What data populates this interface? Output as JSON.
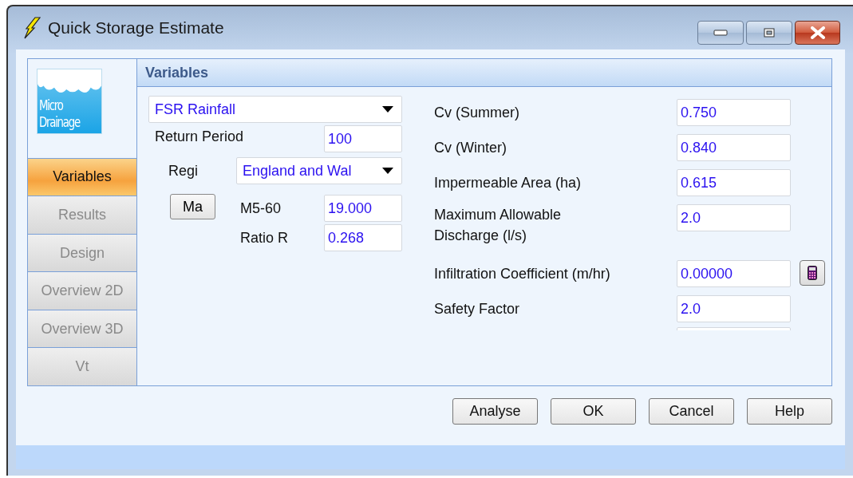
{
  "window": {
    "title": "Quick Storage Estimate"
  },
  "logo": {
    "lines": [
      "Micro",
      "Drainage"
    ]
  },
  "tabs": [
    {
      "label": "Variables",
      "selected": true
    },
    {
      "label": "Results",
      "selected": false
    },
    {
      "label": "Design",
      "selected": false
    },
    {
      "label": "Overview 2D",
      "selected": false
    },
    {
      "label": "Overview 3D",
      "selected": false
    },
    {
      "label": "Vt",
      "selected": false
    }
  ],
  "panel": {
    "title": "Variables"
  },
  "rainfall": {
    "value": "FSR Rainfall"
  },
  "return_period": {
    "label": "Return Period",
    "value": "100"
  },
  "region": {
    "label": "Regi",
    "value": "England and Wal"
  },
  "map_button": "Ma",
  "rain_fields": [
    {
      "label": "M5-60",
      "value": "19.000"
    },
    {
      "label": "Ratio R",
      "value": "0.268"
    }
  ],
  "fields": [
    {
      "label": "Cv (Summer)",
      "value": "0.750",
      "calculator": false
    },
    {
      "label": "Cv (Winter)",
      "value": "0.840",
      "calculator": false
    },
    {
      "label": "Impermeable Area (ha)",
      "value": "0.615",
      "calculator": false
    },
    {
      "label": "Maximum Allowable Discharge (l/s)",
      "value": "2.0",
      "calculator": false
    },
    {
      "label": "Infiltration Coefficient (m/hr)",
      "value": "0.00000",
      "calculator": true
    },
    {
      "label": "Safety Factor",
      "value": "2.0",
      "calculator": false
    }
  ],
  "buttons": [
    "Analyse",
    "OK",
    "Cancel",
    "Help"
  ]
}
